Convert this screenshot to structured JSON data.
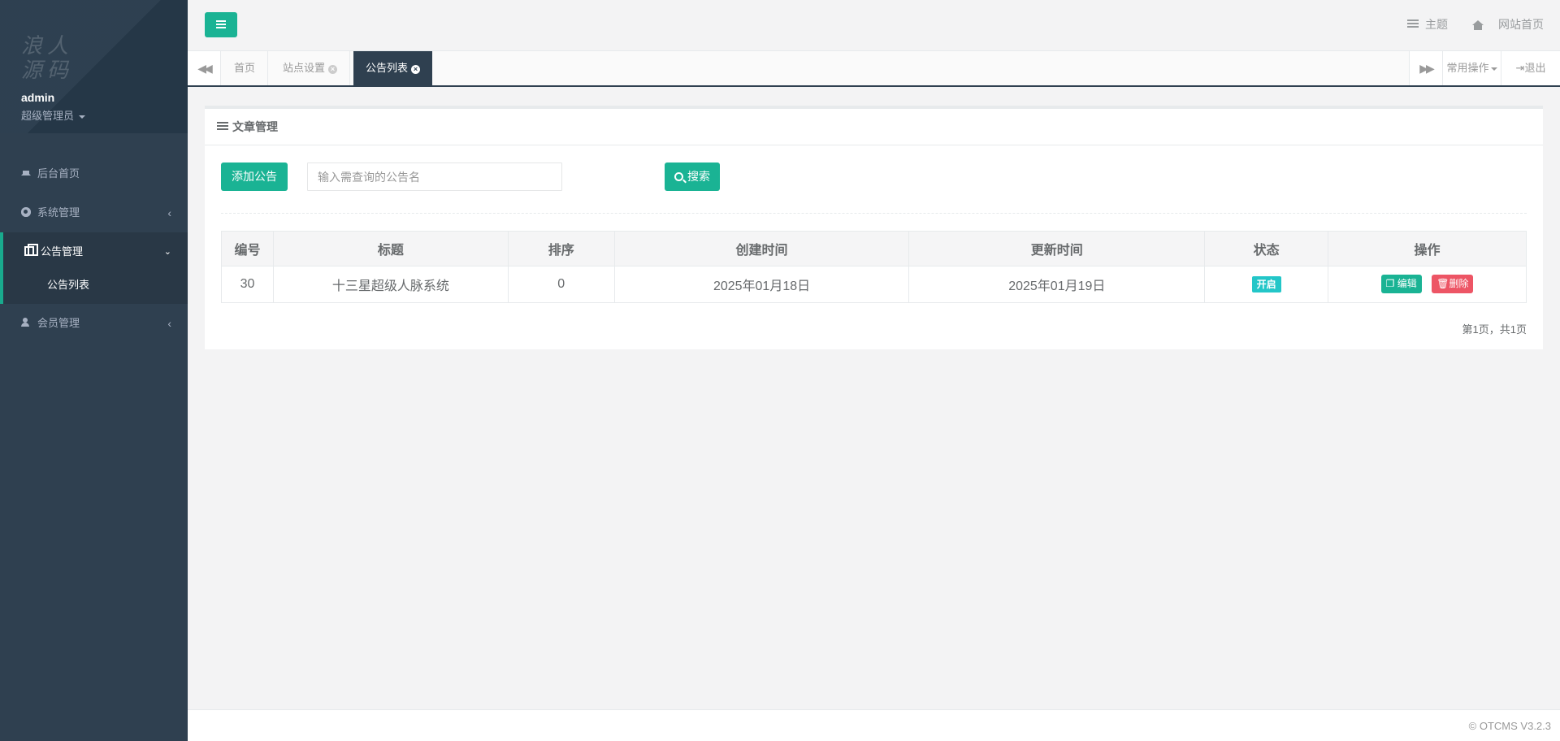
{
  "sidebar": {
    "logo_text": "浪人源码",
    "username": "admin",
    "role": "超级管理员",
    "items": [
      {
        "label": "后台首页",
        "icon": "home-icon"
      },
      {
        "label": "系统管理",
        "icon": "gear-icon"
      },
      {
        "label": "公告管理",
        "icon": "copy-icon"
      },
      {
        "label": "会员管理",
        "icon": "user-icon"
      }
    ],
    "subitems": [
      {
        "label": "公告列表"
      }
    ]
  },
  "topbar": {
    "theme_label": "主题",
    "site_home_label": "网站首页"
  },
  "tabs": {
    "items": [
      {
        "label": "首页"
      },
      {
        "label": "站点设置"
      },
      {
        "label": "公告列表"
      }
    ],
    "common_ops": "常用操作",
    "logout": "退出"
  },
  "panel": {
    "title": "文章管理",
    "add_button": "添加公告",
    "search_placeholder": "输入需查询的公告名",
    "search_button": "搜索",
    "pager": "第1页，共1页"
  },
  "table": {
    "headers": [
      "编号",
      "标题",
      "排序",
      "创建时间",
      "更新时间",
      "状态",
      "操作"
    ],
    "rows": [
      {
        "id": "30",
        "title": "十三星超级人脉系统",
        "sort": "0",
        "created": "2025年01月18日",
        "updated": "2025年01月19日",
        "status": "开启",
        "edit": "编辑",
        "delete": "删除"
      }
    ]
  },
  "footer": {
    "copyright": "© OTCMS V3.2.3"
  },
  "colors": {
    "sidebar_bg": "#2f4050",
    "accent": "#1ab394",
    "status_badge": "#23c6c8",
    "danger": "#ed5565"
  }
}
